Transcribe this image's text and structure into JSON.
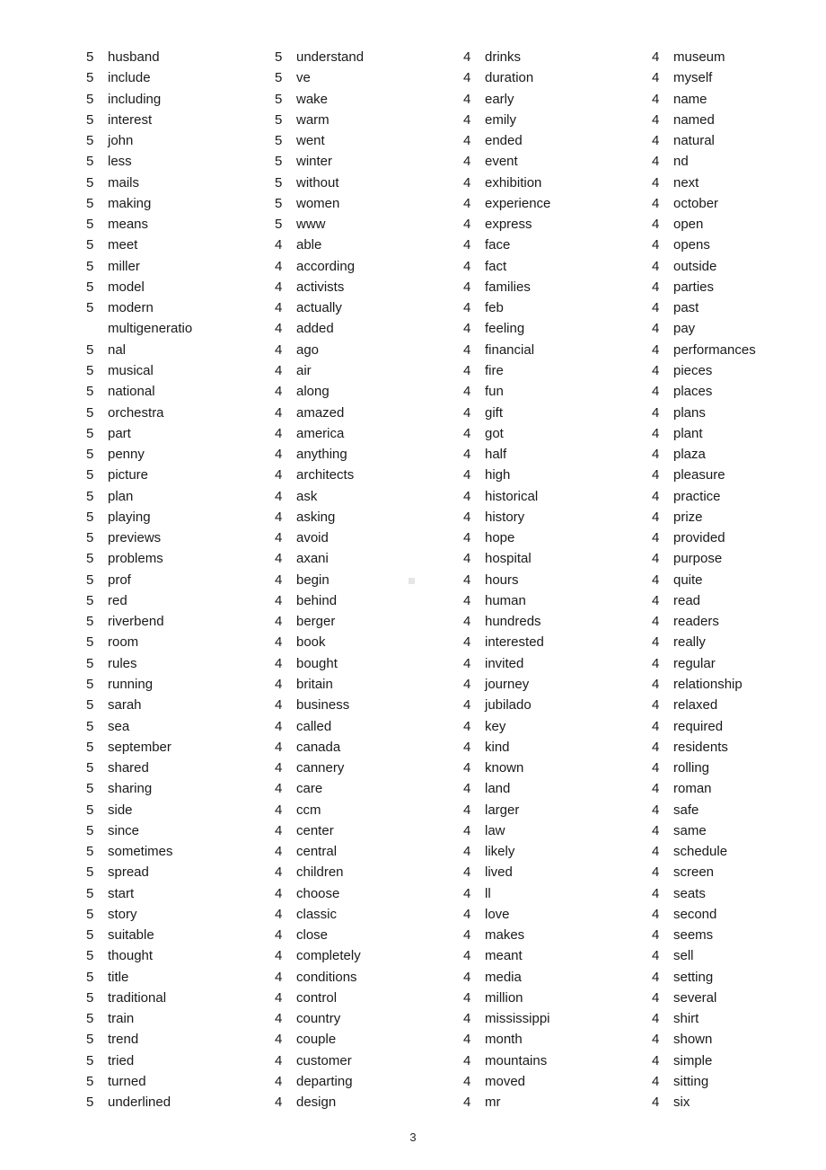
{
  "document": {
    "page_number": "3",
    "text_color": "#1a1a1a",
    "background_color": "#ffffff",
    "artifact_color": "#e6e6e6"
  },
  "columns": [
    {
      "id": "column-1",
      "rows": [
        {
          "count": "5",
          "word": "husband"
        },
        {
          "count": "5",
          "word": "include"
        },
        {
          "count": "5",
          "word": "including"
        },
        {
          "count": "5",
          "word": "interest"
        },
        {
          "count": "5",
          "word": "john"
        },
        {
          "count": "5",
          "word": "less"
        },
        {
          "count": "5",
          "word": "mails"
        },
        {
          "count": "5",
          "word": "making"
        },
        {
          "count": "5",
          "word": "means"
        },
        {
          "count": "5",
          "word": "meet"
        },
        {
          "count": "5",
          "word": "miller"
        },
        {
          "count": "5",
          "word": "model"
        },
        {
          "count": "5",
          "word": "modern"
        },
        {
          "count": "",
          "word": "multigeneratio",
          "continuation": true
        },
        {
          "count": "5",
          "word": "nal"
        },
        {
          "count": "5",
          "word": "musical"
        },
        {
          "count": "5",
          "word": "national"
        },
        {
          "count": "5",
          "word": "orchestra"
        },
        {
          "count": "5",
          "word": "part"
        },
        {
          "count": "5",
          "word": "penny"
        },
        {
          "count": "5",
          "word": "picture"
        },
        {
          "count": "5",
          "word": "plan"
        },
        {
          "count": "5",
          "word": "playing"
        },
        {
          "count": "5",
          "word": "previews"
        },
        {
          "count": "5",
          "word": "problems"
        },
        {
          "count": "5",
          "word": "prof"
        },
        {
          "count": "5",
          "word": "red"
        },
        {
          "count": "5",
          "word": "riverbend"
        },
        {
          "count": "5",
          "word": "room"
        },
        {
          "count": "5",
          "word": "rules"
        },
        {
          "count": "5",
          "word": "running"
        },
        {
          "count": "5",
          "word": "sarah"
        },
        {
          "count": "5",
          "word": "sea"
        },
        {
          "count": "5",
          "word": "september"
        },
        {
          "count": "5",
          "word": "shared"
        },
        {
          "count": "5",
          "word": "sharing"
        },
        {
          "count": "5",
          "word": "side"
        },
        {
          "count": "5",
          "word": "since"
        },
        {
          "count": "5",
          "word": "sometimes"
        },
        {
          "count": "5",
          "word": "spread"
        },
        {
          "count": "5",
          "word": "start"
        },
        {
          "count": "5",
          "word": "story"
        },
        {
          "count": "5",
          "word": "suitable"
        },
        {
          "count": "5",
          "word": "thought"
        },
        {
          "count": "5",
          "word": "title"
        },
        {
          "count": "5",
          "word": "traditional"
        },
        {
          "count": "5",
          "word": "train"
        },
        {
          "count": "5",
          "word": "trend"
        },
        {
          "count": "5",
          "word": "tried"
        },
        {
          "count": "5",
          "word": "turned"
        },
        {
          "count": "5",
          "word": "underlined"
        }
      ]
    },
    {
      "id": "column-2",
      "rows": [
        {
          "count": "5",
          "word": "understand"
        },
        {
          "count": "5",
          "word": "ve"
        },
        {
          "count": "5",
          "word": "wake"
        },
        {
          "count": "5",
          "word": "warm"
        },
        {
          "count": "5",
          "word": "went"
        },
        {
          "count": "5",
          "word": "winter"
        },
        {
          "count": "5",
          "word": "without"
        },
        {
          "count": "5",
          "word": "women"
        },
        {
          "count": "5",
          "word": "www"
        },
        {
          "count": "4",
          "word": "able"
        },
        {
          "count": "4",
          "word": "according"
        },
        {
          "count": "4",
          "word": "activists"
        },
        {
          "count": "4",
          "word": "actually"
        },
        {
          "count": "4",
          "word": "added"
        },
        {
          "count": "4",
          "word": "ago"
        },
        {
          "count": "4",
          "word": "air"
        },
        {
          "count": "4",
          "word": "along"
        },
        {
          "count": "4",
          "word": "amazed"
        },
        {
          "count": "4",
          "word": "america"
        },
        {
          "count": "4",
          "word": "anything"
        },
        {
          "count": "4",
          "word": "architects"
        },
        {
          "count": "4",
          "word": "ask"
        },
        {
          "count": "4",
          "word": "asking"
        },
        {
          "count": "4",
          "word": "avoid"
        },
        {
          "count": "4",
          "word": "axani"
        },
        {
          "count": "4",
          "word": "begin"
        },
        {
          "count": "4",
          "word": "behind"
        },
        {
          "count": "4",
          "word": "berger"
        },
        {
          "count": "4",
          "word": "book"
        },
        {
          "count": "4",
          "word": "bought"
        },
        {
          "count": "4",
          "word": "britain"
        },
        {
          "count": "4",
          "word": "business"
        },
        {
          "count": "4",
          "word": "called"
        },
        {
          "count": "4",
          "word": "canada"
        },
        {
          "count": "4",
          "word": "cannery"
        },
        {
          "count": "4",
          "word": "care"
        },
        {
          "count": "4",
          "word": "ccm"
        },
        {
          "count": "4",
          "word": "center"
        },
        {
          "count": "4",
          "word": "central"
        },
        {
          "count": "4",
          "word": "children"
        },
        {
          "count": "4",
          "word": "choose"
        },
        {
          "count": "4",
          "word": "classic"
        },
        {
          "count": "4",
          "word": "close"
        },
        {
          "count": "4",
          "word": "completely"
        },
        {
          "count": "4",
          "word": "conditions"
        },
        {
          "count": "4",
          "word": "control"
        },
        {
          "count": "4",
          "word": "country"
        },
        {
          "count": "4",
          "word": "couple"
        },
        {
          "count": "4",
          "word": "customer"
        },
        {
          "count": "4",
          "word": "departing"
        },
        {
          "count": "4",
          "word": "design"
        }
      ]
    },
    {
      "id": "column-3",
      "rows": [
        {
          "count": "4",
          "word": "drinks"
        },
        {
          "count": "4",
          "word": "duration"
        },
        {
          "count": "4",
          "word": "early"
        },
        {
          "count": "4",
          "word": "emily"
        },
        {
          "count": "4",
          "word": "ended"
        },
        {
          "count": "4",
          "word": "event"
        },
        {
          "count": "4",
          "word": "exhibition"
        },
        {
          "count": "4",
          "word": "experience"
        },
        {
          "count": "4",
          "word": "express"
        },
        {
          "count": "4",
          "word": "face"
        },
        {
          "count": "4",
          "word": "fact"
        },
        {
          "count": "4",
          "word": "families"
        },
        {
          "count": "4",
          "word": "feb"
        },
        {
          "count": "4",
          "word": "feeling"
        },
        {
          "count": "4",
          "word": "financial"
        },
        {
          "count": "4",
          "word": "fire"
        },
        {
          "count": "4",
          "word": "fun"
        },
        {
          "count": "4",
          "word": "gift"
        },
        {
          "count": "4",
          "word": "got"
        },
        {
          "count": "4",
          "word": "half"
        },
        {
          "count": "4",
          "word": "high"
        },
        {
          "count": "4",
          "word": "historical"
        },
        {
          "count": "4",
          "word": "history"
        },
        {
          "count": "4",
          "word": "hope"
        },
        {
          "count": "4",
          "word": "hospital"
        },
        {
          "count": "4",
          "word": "hours"
        },
        {
          "count": "4",
          "word": "human"
        },
        {
          "count": "4",
          "word": "hundreds"
        },
        {
          "count": "4",
          "word": "interested"
        },
        {
          "count": "4",
          "word": "invited"
        },
        {
          "count": "4",
          "word": "journey"
        },
        {
          "count": "4",
          "word": "jubilado"
        },
        {
          "count": "4",
          "word": "key"
        },
        {
          "count": "4",
          "word": "kind"
        },
        {
          "count": "4",
          "word": "known"
        },
        {
          "count": "4",
          "word": "land"
        },
        {
          "count": "4",
          "word": "larger"
        },
        {
          "count": "4",
          "word": "law"
        },
        {
          "count": "4",
          "word": "likely"
        },
        {
          "count": "4",
          "word": "lived"
        },
        {
          "count": "4",
          "word": "ll"
        },
        {
          "count": "4",
          "word": "love"
        },
        {
          "count": "4",
          "word": "makes"
        },
        {
          "count": "4",
          "word": "meant"
        },
        {
          "count": "4",
          "word": "media"
        },
        {
          "count": "4",
          "word": "million"
        },
        {
          "count": "4",
          "word": "mississippi"
        },
        {
          "count": "4",
          "word": "month"
        },
        {
          "count": "4",
          "word": "mountains"
        },
        {
          "count": "4",
          "word": "moved"
        },
        {
          "count": "4",
          "word": "mr"
        }
      ]
    },
    {
      "id": "column-4",
      "rows": [
        {
          "count": "4",
          "word": "museum"
        },
        {
          "count": "4",
          "word": "myself"
        },
        {
          "count": "4",
          "word": "name"
        },
        {
          "count": "4",
          "word": "named"
        },
        {
          "count": "4",
          "word": "natural"
        },
        {
          "count": "4",
          "word": "nd"
        },
        {
          "count": "4",
          "word": "next"
        },
        {
          "count": "4",
          "word": "october"
        },
        {
          "count": "4",
          "word": "open"
        },
        {
          "count": "4",
          "word": "opens"
        },
        {
          "count": "4",
          "word": "outside"
        },
        {
          "count": "4",
          "word": "parties"
        },
        {
          "count": "4",
          "word": "past"
        },
        {
          "count": "4",
          "word": "pay"
        },
        {
          "count": "4",
          "word": "performances"
        },
        {
          "count": "4",
          "word": "pieces"
        },
        {
          "count": "4",
          "word": "places"
        },
        {
          "count": "4",
          "word": "plans"
        },
        {
          "count": "4",
          "word": "plant"
        },
        {
          "count": "4",
          "word": "plaza"
        },
        {
          "count": "4",
          "word": "pleasure"
        },
        {
          "count": "4",
          "word": "practice"
        },
        {
          "count": "4",
          "word": "prize"
        },
        {
          "count": "4",
          "word": "provided"
        },
        {
          "count": "4",
          "word": "purpose"
        },
        {
          "count": "4",
          "word": "quite"
        },
        {
          "count": "4",
          "word": "read"
        },
        {
          "count": "4",
          "word": "readers"
        },
        {
          "count": "4",
          "word": "really"
        },
        {
          "count": "4",
          "word": "regular"
        },
        {
          "count": "4",
          "word": "relationship"
        },
        {
          "count": "4",
          "word": "relaxed"
        },
        {
          "count": "4",
          "word": "required"
        },
        {
          "count": "4",
          "word": "residents"
        },
        {
          "count": "4",
          "word": "rolling"
        },
        {
          "count": "4",
          "word": "roman"
        },
        {
          "count": "4",
          "word": "safe"
        },
        {
          "count": "4",
          "word": "same"
        },
        {
          "count": "4",
          "word": "schedule"
        },
        {
          "count": "4",
          "word": "screen"
        },
        {
          "count": "4",
          "word": "seats"
        },
        {
          "count": "4",
          "word": "second"
        },
        {
          "count": "4",
          "word": "seems"
        },
        {
          "count": "4",
          "word": "sell"
        },
        {
          "count": "4",
          "word": "setting"
        },
        {
          "count": "4",
          "word": "several"
        },
        {
          "count": "4",
          "word": "shirt"
        },
        {
          "count": "4",
          "word": "shown"
        },
        {
          "count": "4",
          "word": "simple"
        },
        {
          "count": "4",
          "word": "sitting"
        },
        {
          "count": "4",
          "word": "six"
        }
      ]
    }
  ]
}
